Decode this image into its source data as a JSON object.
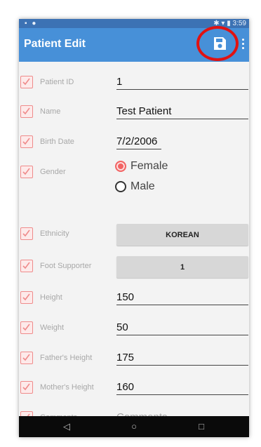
{
  "status_bar": {
    "time": "3:59"
  },
  "app_bar": {
    "title": "Patient Edit",
    "save_icon": "save-icon",
    "menu_icon": "more-vert-icon",
    "highlight_color": "#e11212"
  },
  "form": {
    "patient_id": {
      "label": "Patient ID",
      "value": "1"
    },
    "name": {
      "label": "Name",
      "value": "Test Patient"
    },
    "birth_date": {
      "label": "Birth Date",
      "value": "7/2/2006"
    },
    "gender": {
      "label": "Gender",
      "options": [
        "Female",
        "Male"
      ],
      "selected": "Female"
    },
    "ethnicity": {
      "label": "Ethnicity",
      "value": "KOREAN"
    },
    "foot_supporter": {
      "label": "Foot Supporter",
      "value": "1"
    },
    "height": {
      "label": "Height",
      "value": "150"
    },
    "weight": {
      "label": "Weight",
      "value": "50"
    },
    "fathers_height": {
      "label": "Father's Height",
      "value": "175"
    },
    "mothers_height": {
      "label": "Mother's Height",
      "value": "160"
    },
    "comments": {
      "label": "Comments",
      "value": "",
      "placeholder": "Comments"
    }
  },
  "nav_bar": {
    "back": "◁",
    "home": "○",
    "recents": "□"
  },
  "colors": {
    "status_bar": "#3c72b4",
    "app_bar": "#4790d8",
    "checkbox": "#ef8b8b",
    "radio_accent": "#f26363"
  }
}
